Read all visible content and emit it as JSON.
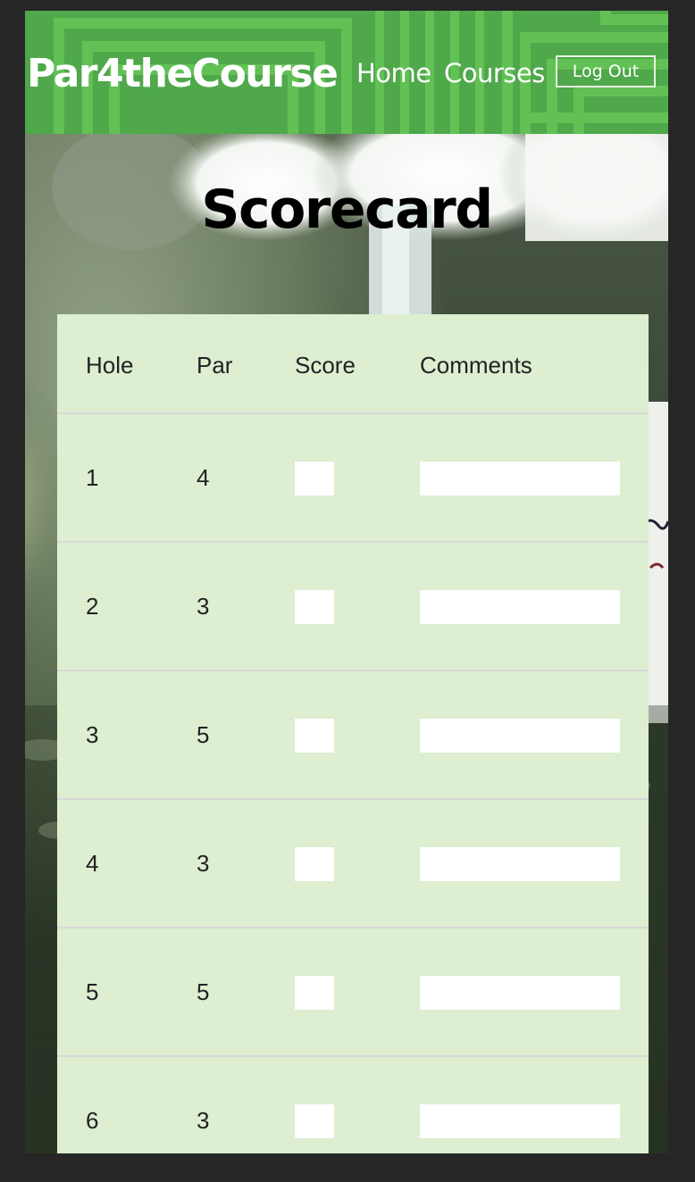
{
  "header": {
    "brand": "Par4theCourse",
    "nav": {
      "home": "Home",
      "courses": "Courses"
    },
    "logout_label": "Log Out"
  },
  "page": {
    "title": "Scorecard"
  },
  "scorecard": {
    "columns": {
      "hole": "Hole",
      "par": "Par",
      "score": "Score",
      "comments": "Comments"
    },
    "rows": [
      {
        "hole": "1",
        "par": "4",
        "score": "",
        "comment": ""
      },
      {
        "hole": "2",
        "par": "3",
        "score": "",
        "comment": ""
      },
      {
        "hole": "3",
        "par": "5",
        "score": "",
        "comment": ""
      },
      {
        "hole": "4",
        "par": "3",
        "score": "",
        "comment": ""
      },
      {
        "hole": "5",
        "par": "5",
        "score": "",
        "comment": ""
      },
      {
        "hole": "6",
        "par": "3",
        "score": "",
        "comment": ""
      }
    ]
  },
  "colors": {
    "header_green": "#4fa84a",
    "header_stripe": "#62c155",
    "card_bg": "#ddeed1",
    "page_bg": "#262626"
  }
}
